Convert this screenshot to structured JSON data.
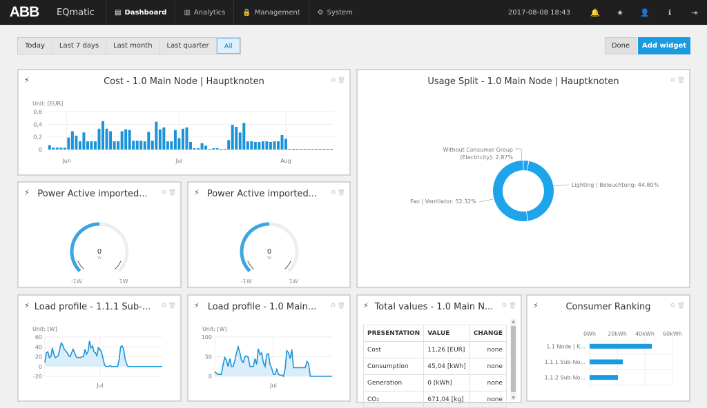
{
  "topbar": {
    "logo": "ABB",
    "app_name": "EQmatic",
    "nav": [
      {
        "label": "Dashboard",
        "icon": "dashboard-icon",
        "glyph": "▤",
        "active": true
      },
      {
        "label": "Analytics",
        "icon": "bar-chart-icon",
        "glyph": "▥",
        "active": false
      },
      {
        "label": "Management",
        "icon": "lock-icon",
        "glyph": "🔒",
        "active": false
      },
      {
        "label": "System",
        "icon": "sliders-icon",
        "glyph": "⚙",
        "active": false
      }
    ],
    "datetime": "2017-08-08 18:43",
    "icons": [
      {
        "name": "bell-icon",
        "glyph": "🔔"
      },
      {
        "name": "star-icon",
        "glyph": "★"
      },
      {
        "name": "user-icon",
        "glyph": "👤"
      },
      {
        "name": "info-icon",
        "glyph": "ℹ"
      },
      {
        "name": "logout-icon",
        "glyph": "⇥"
      }
    ]
  },
  "filters": {
    "items": [
      "Today",
      "Last 7 days",
      "Last month",
      "Last quarter",
      "All"
    ],
    "active": "All"
  },
  "actions": {
    "done": "Done",
    "add_widget": "Add widget"
  },
  "colors": {
    "accent": "#1a9ae0",
    "bar": "#1b93d8",
    "donut": "#1ea4ea",
    "gauge": "#3aa7e0"
  },
  "widgets": {
    "cost": {
      "title": "Cost - 1.0 Main Node | Hauptknoten",
      "unit": "Unit: [EUR]"
    },
    "usage_split": {
      "title": "Usage Split - 1.0 Main Node | Hauptknoten"
    },
    "power1": {
      "title": "Power Active imported...",
      "value": "0",
      "unit": "W",
      "min": "-1W",
      "max": "1W"
    },
    "power2": {
      "title": "Power Active imported...",
      "value": "0",
      "unit": "W",
      "min": "-1W",
      "max": "1W"
    },
    "load1": {
      "title": "Load profile - 1.1.1 Sub-...",
      "unit": "Unit: [W]"
    },
    "load2": {
      "title": "Load profile - 1.0 Main...",
      "unit": "Unit: [W]"
    },
    "totals": {
      "title": "Total values - 1.0 Main N...",
      "headers": [
        "PRESENTATION",
        "VALUE",
        "CHANGE"
      ],
      "rows": [
        [
          "Cost",
          "11,26 [EUR]",
          "none"
        ],
        [
          "Consumption",
          "45,04 [kWh]",
          "none"
        ],
        [
          "Generation",
          "0 [kWh]",
          "none"
        ],
        [
          "CO₂",
          "671,04 [kg]",
          "none"
        ]
      ]
    },
    "ranking": {
      "title": "Consumer Ranking"
    }
  },
  "chart_data": [
    {
      "id": "cost",
      "type": "bar",
      "title": "Cost - 1.0 Main Node | Hauptknoten",
      "ylabel": "Unit: [EUR]",
      "ylim": [
        0,
        0.6
      ],
      "yticks": [
        "0",
        "0,2",
        "0,4",
        "0,6"
      ],
      "xticks": [
        "Jun",
        "Jul",
        "Aug"
      ],
      "xtick_index": [
        4.5,
        34,
        62
      ],
      "values": [
        0.07,
        0.03,
        0.03,
        0.03,
        0.03,
        0.19,
        0.29,
        0.22,
        0.13,
        0.27,
        0.13,
        0.13,
        0.13,
        0.33,
        0.45,
        0.33,
        0.29,
        0.13,
        0.13,
        0.29,
        0.32,
        0.31,
        0.14,
        0.14,
        0.14,
        0.13,
        0.28,
        0.14,
        0.44,
        0.32,
        0.35,
        0.13,
        0.13,
        0.31,
        0.18,
        0.33,
        0.35,
        0.12,
        0.02,
        0.02,
        0.1,
        0.06,
        0.005,
        0.02,
        0.02,
        0.005,
        0.005,
        0.15,
        0.39,
        0.36,
        0.27,
        0.42,
        0.13,
        0.13,
        0.12,
        0.12,
        0.13,
        0.13,
        0.12,
        0.13,
        0.13,
        0.23,
        0.17,
        0.003,
        0,
        0,
        0.003,
        0.003,
        0.003,
        0.003,
        0.003,
        0.003,
        0.003,
        0.003,
        0.003
      ]
    },
    {
      "id": "usage_split",
      "type": "pie",
      "donut": true,
      "slices": [
        {
          "label": "Without Consumer Group (Electricity): 2.87%",
          "value": 2.87
        },
        {
          "label": "Lighting | Beleuchtung: 44.80%",
          "value": 44.8
        },
        {
          "label": "Fan | Ventilator: 52.32%",
          "value": 52.32
        }
      ]
    },
    {
      "id": "gauge1",
      "type": "gauge",
      "value": 0,
      "min": -1,
      "max": 1,
      "unit": "W"
    },
    {
      "id": "gauge2",
      "type": "gauge",
      "value": 0,
      "min": -1,
      "max": 1,
      "unit": "W"
    },
    {
      "id": "load1",
      "type": "area",
      "ylabel": "Unit: [W]",
      "ylim": [
        -20,
        60
      ],
      "yticks": [
        "60",
        "40",
        "20",
        "0",
        "-20"
      ],
      "xticks": [
        "Jul"
      ],
      "xtick_frac": 0.47,
      "values": [
        8,
        28,
        30,
        18,
        20,
        38,
        25,
        18,
        20,
        22,
        35,
        48,
        44,
        35,
        32,
        28,
        22,
        20,
        28,
        35,
        28,
        20,
        18,
        18,
        18,
        20,
        20,
        35,
        25,
        30,
        52,
        38,
        42,
        30,
        28,
        22,
        38,
        35,
        30,
        18,
        5,
        0,
        0,
        0,
        2,
        0,
        0,
        0,
        0,
        0,
        15,
        40,
        42,
        35,
        15,
        5,
        0,
        0,
        0,
        0,
        0,
        0,
        0,
        0,
        0,
        0,
        0,
        0,
        0,
        0,
        0,
        0,
        0,
        0,
        0,
        0,
        0,
        0,
        0,
        0
      ]
    },
    {
      "id": "load2",
      "type": "area",
      "ylabel": "Unit: [W]",
      "ylim": [
        0,
        100
      ],
      "yticks": [
        "100",
        "50",
        "0"
      ],
      "xticks": [
        "Jul"
      ],
      "xtick_frac": 0.5,
      "values": [
        12,
        8,
        5,
        5,
        5,
        30,
        48,
        40,
        25,
        45,
        25,
        25,
        40,
        60,
        75,
        60,
        40,
        35,
        50,
        52,
        48,
        25,
        25,
        25,
        45,
        30,
        70,
        55,
        60,
        35,
        25,
        55,
        58,
        30,
        20,
        5,
        5,
        18,
        5,
        3,
        3,
        0,
        20,
        65,
        60,
        45,
        68,
        22,
        22,
        22,
        22,
        22,
        22,
        22,
        22,
        38,
        32,
        0,
        0,
        0,
        0,
        0,
        0,
        0,
        0,
        0,
        0,
        0,
        0,
        0,
        0
      ]
    },
    {
      "id": "ranking",
      "type": "bar",
      "orientation": "horizontal",
      "categories": [
        "1.1 Node | K...",
        "1.1.1 Sub-No...",
        "1.1.2 Sub-No..."
      ],
      "values": [
        45,
        24,
        20.5
      ],
      "xlim": [
        0,
        60
      ],
      "xticks": [
        "0Wh",
        "20kWh",
        "40kWh",
        "60kWh"
      ]
    }
  ]
}
